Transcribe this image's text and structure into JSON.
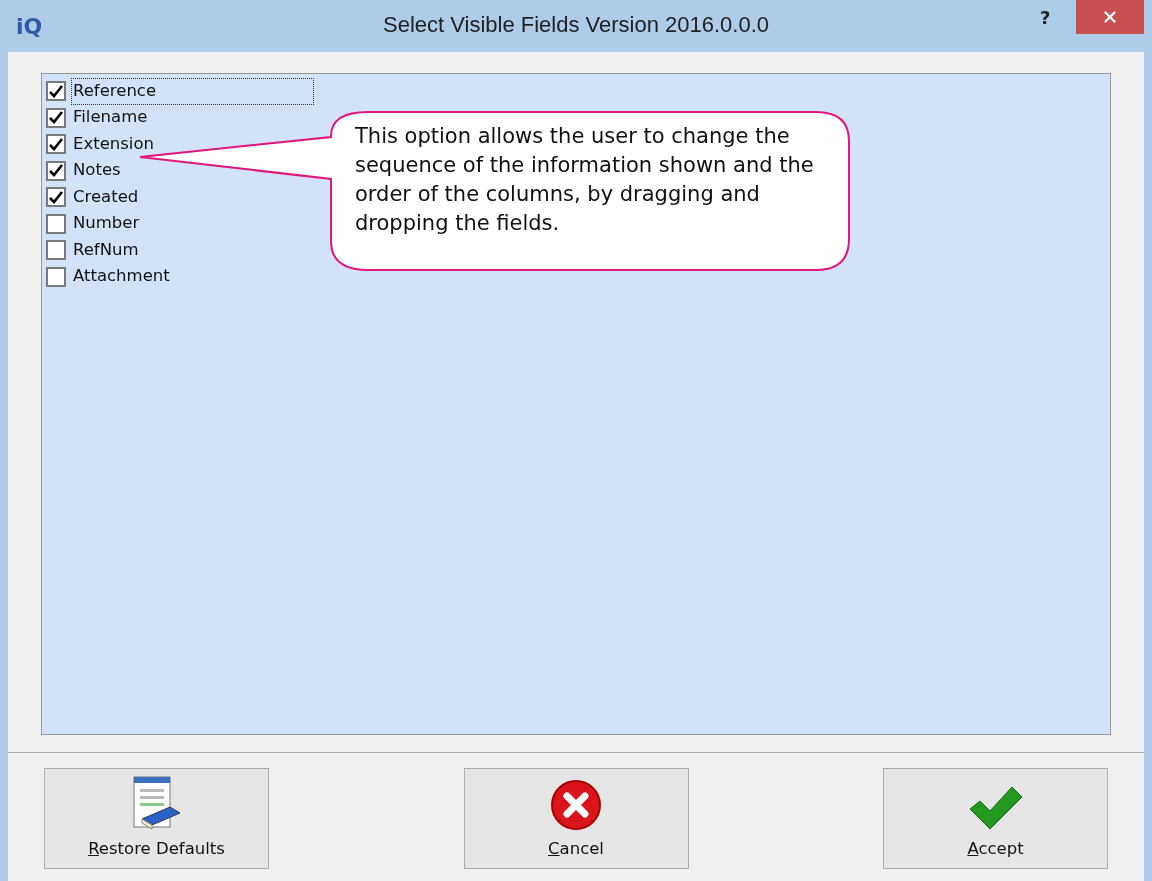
{
  "window": {
    "logo": "iQ",
    "title": "Select Visible Fields Version 2016.0.0.0",
    "help": "?"
  },
  "fields": [
    {
      "label": "Reference",
      "checked": true,
      "selected": true
    },
    {
      "label": "Filename",
      "checked": true,
      "selected": false
    },
    {
      "label": "Extension",
      "checked": true,
      "selected": false
    },
    {
      "label": "Notes",
      "checked": true,
      "selected": false
    },
    {
      "label": "Created",
      "checked": true,
      "selected": false
    },
    {
      "label": "Number",
      "checked": false,
      "selected": false
    },
    {
      "label": "RefNum",
      "checked": false,
      "selected": false
    },
    {
      "label": "Attachment",
      "checked": false,
      "selected": false
    }
  ],
  "callout": {
    "text": "This option allows the user to change the sequence of the information shown and the order of the columns, by dragging and dropping the fields."
  },
  "buttons": [
    {
      "kind": "restore",
      "label": "Restore Defaults"
    },
    {
      "kind": "cancel",
      "label": "Cancel"
    },
    {
      "kind": "accept",
      "label": "Accept"
    }
  ]
}
